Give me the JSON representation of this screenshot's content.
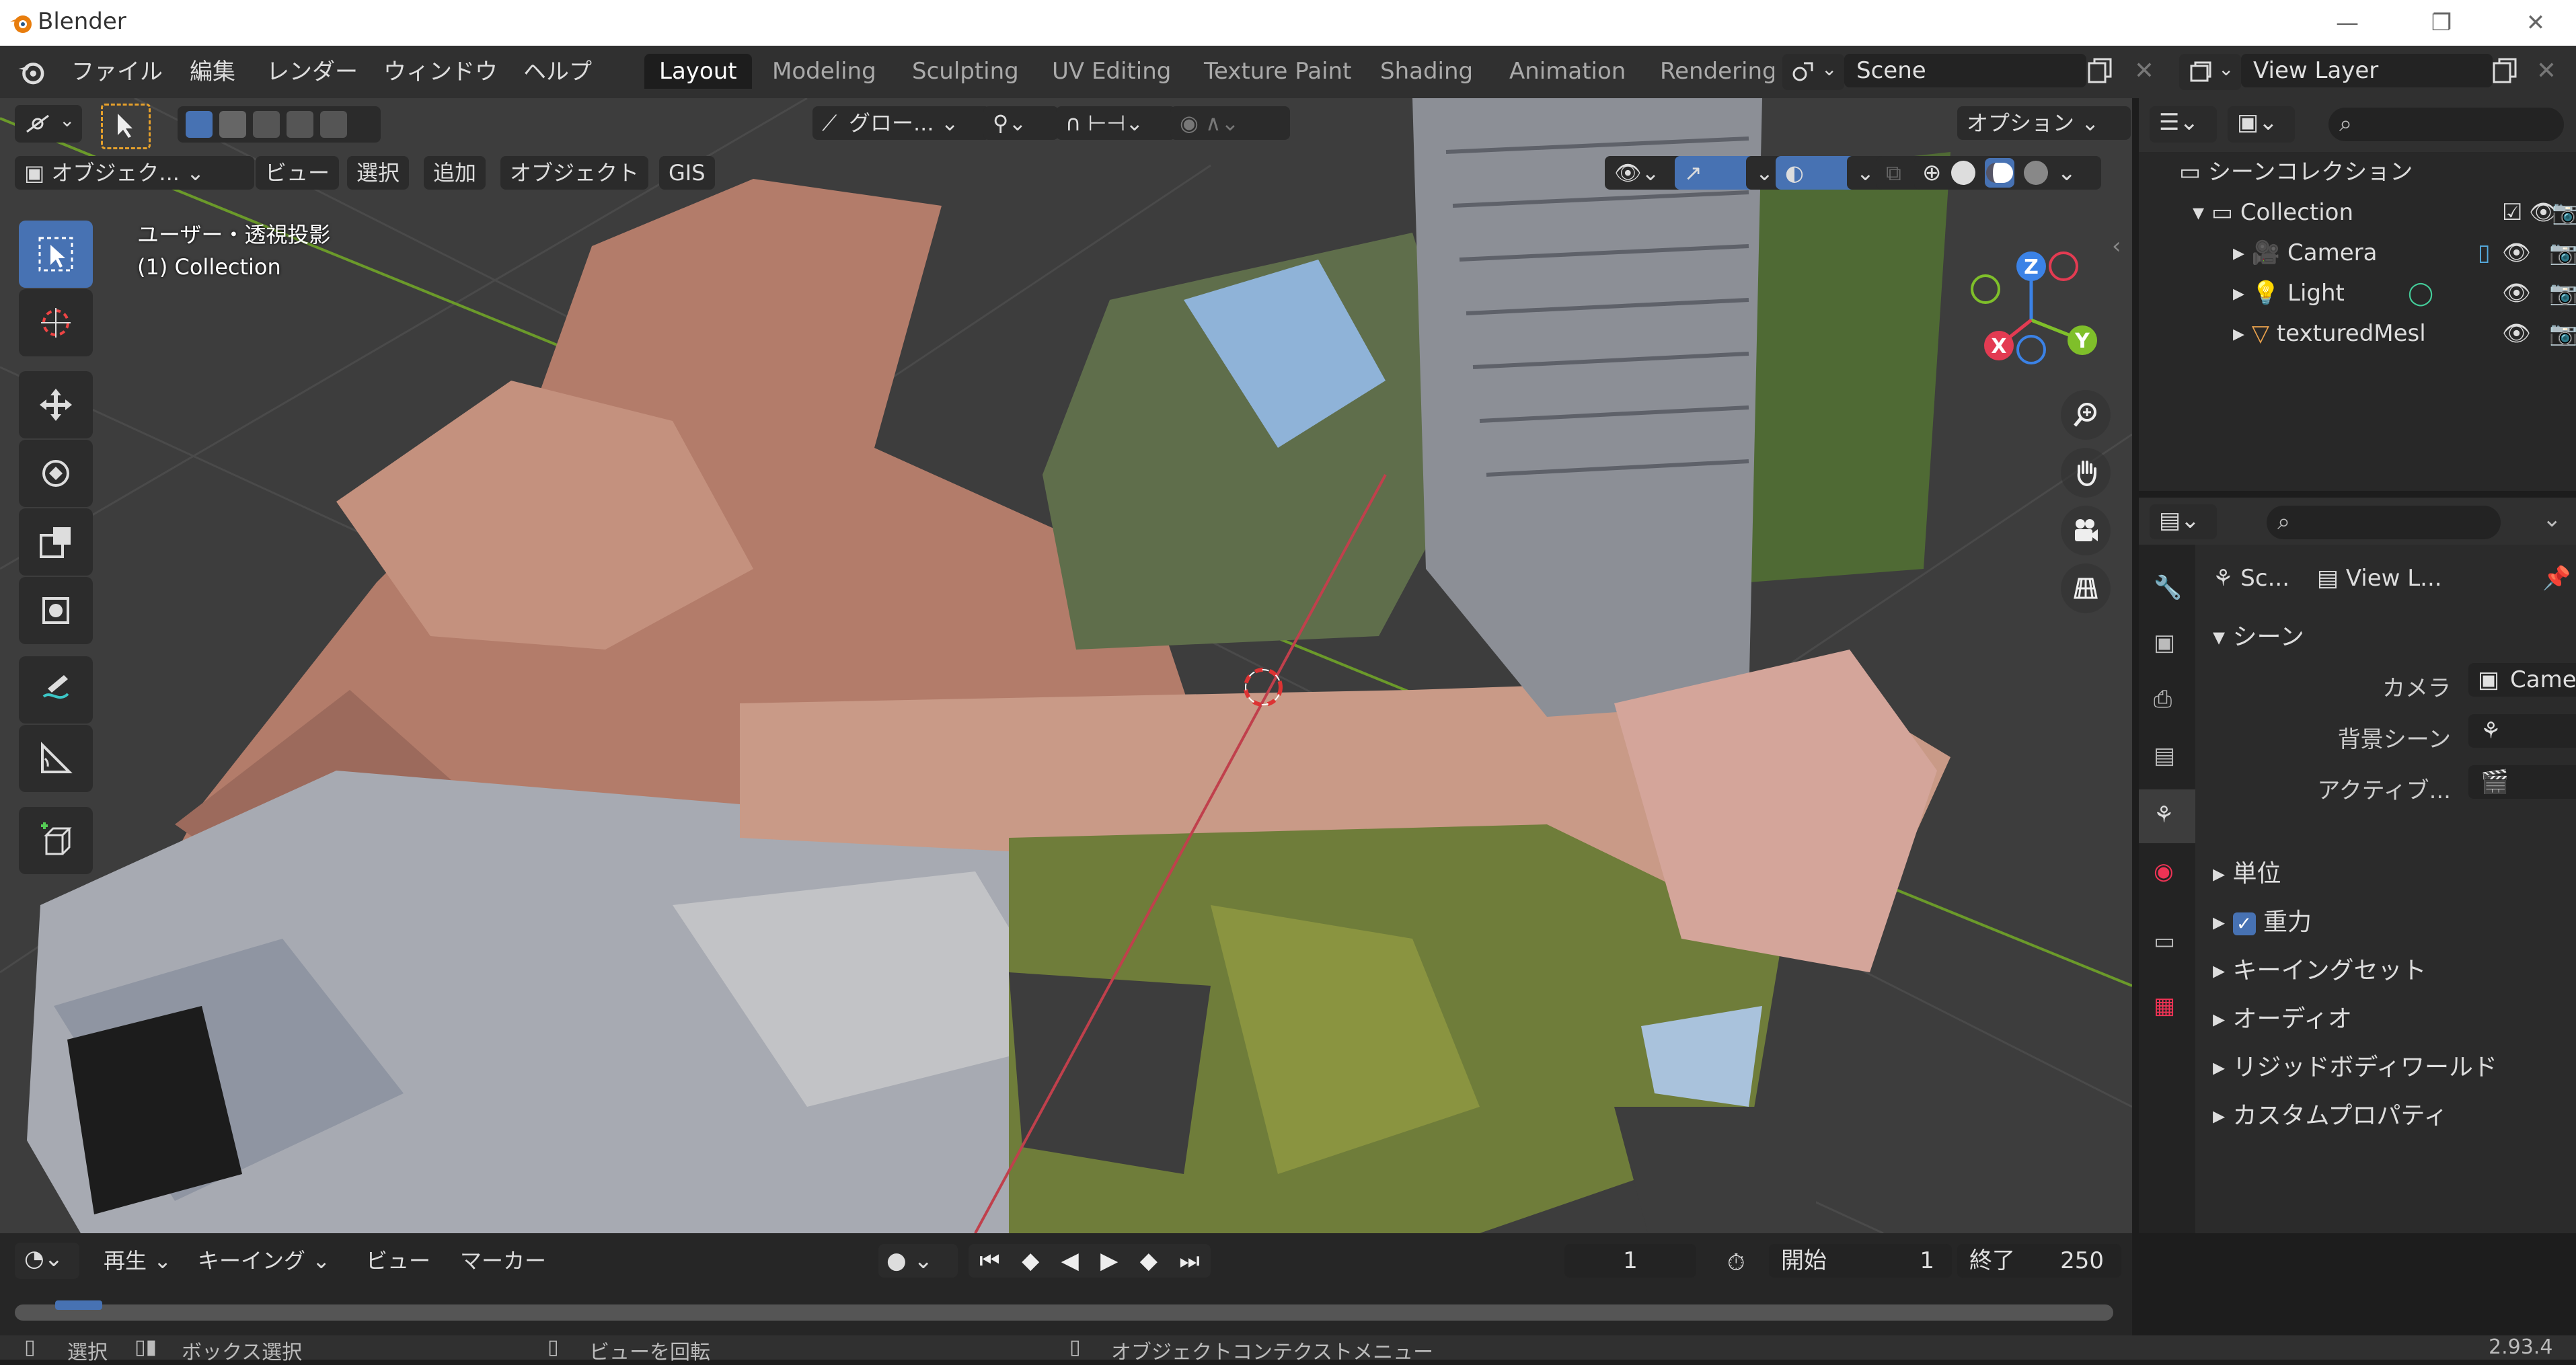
{
  "window": {
    "title": "Blender"
  },
  "menus": [
    "ファイル",
    "編集",
    "レンダー",
    "ウィンドウ",
    "ヘルプ"
  ],
  "workspaces": [
    "Layout",
    "Modeling",
    "Sculpting",
    "UV Editing",
    "Texture Paint",
    "Shading",
    "Animation",
    "Rendering"
  ],
  "scene_field": "Scene",
  "viewlayer_field": "View Layer",
  "viewport": {
    "transform_orientation": "グロー...",
    "options_label": "オプション",
    "mode_label": "オブジェク...",
    "header_menus": [
      "ビュー",
      "選択",
      "追加",
      "オブジェクト",
      "GIS"
    ],
    "overlay_line1": "ユーザー・透視投影",
    "overlay_line2": "(1) Collection",
    "gizmo": {
      "z": "Z",
      "y": "Y",
      "x": "X"
    }
  },
  "outliner": {
    "root": "シーンコレクション",
    "collection": "Collection",
    "items": [
      "Camera",
      "Light",
      "texturedMesl"
    ]
  },
  "properties": {
    "breadcrumb_scene": "Sc...",
    "breadcrumb_layer": "View L...",
    "section_scene": "シーン",
    "camera_label": "カメラ",
    "camera_value": "Camera",
    "bg_scene_label": "背景シーン",
    "active_label": "アクティブ...",
    "subsections": [
      "単位",
      "重力",
      "キーイングセット",
      "オーディオ",
      "リジッドボディワールド",
      "カスタムプロパティ"
    ]
  },
  "timeline": {
    "menus": [
      "再生",
      "キーイング",
      "ビュー",
      "マーカー"
    ],
    "current_frame": "1",
    "start_label": "開始",
    "start_value": "1",
    "end_label": "終了",
    "end_value": "250"
  },
  "status": {
    "select": "選択",
    "box_select": "ボックス選択",
    "rotate_view": "ビューを回転",
    "context_menu": "オブジェクトコンテクストメニュー",
    "version": "2.93.4"
  },
  "colors": {
    "accent": "#4772b3",
    "axis_x": "#e33b52",
    "axis_y": "#7fbf2a",
    "axis_z": "#3b82e6"
  }
}
